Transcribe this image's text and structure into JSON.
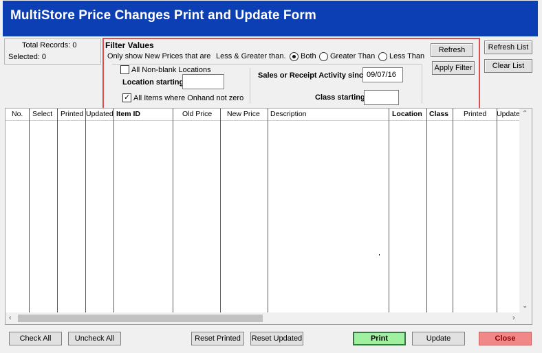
{
  "window": {
    "title": "MultiStore Price Changes Print and Update Form"
  },
  "stats": {
    "total_records": "Total Records: 0",
    "selected": "Selected: 0"
  },
  "filter": {
    "heading": "Filter Values",
    "only_show_label": "Only show New Prices that are",
    "less_greater_label": "Less & Greater than.",
    "radio_both": "Both",
    "radio_greater": "Greater Than",
    "radio_less": "Less Than",
    "selected_radio": "Both",
    "non_blank_label": "All Non-blank Locations",
    "non_blank_checked": false,
    "location_starting_label": "Location starting",
    "location_starting_value": "",
    "all_items_label": "All Items where Onhand not zero",
    "all_items_checked": true,
    "activity_label": "Sales or Receipt Activity since",
    "activity_date": "09/07/16",
    "class_starting_label": "Class starting",
    "class_starting_value": "",
    "refresh_label": "Refresh",
    "apply_filter_label": "Apply Filter"
  },
  "side_buttons": {
    "refresh_list": "Refresh List",
    "clear_list": "Clear List"
  },
  "grid": {
    "columns": [
      "No.",
      "Select",
      "Printed",
      "Updated",
      "Item ID",
      "Old Price",
      "New Price",
      "Description",
      "Location",
      "Class",
      "Printed",
      "Update"
    ],
    "rows": []
  },
  "bottom_buttons": {
    "check_all": "Check All",
    "uncheck_all": "Uncheck All",
    "reset_printed": "Reset Printed",
    "reset_updated": "Reset Updated",
    "print": "Print",
    "update": "Update",
    "close": "Close"
  },
  "colors": {
    "title_bar": "#0c3fb4",
    "print_button": "#9ff0a0",
    "close_button": "#f08888",
    "filter_border": "#d65050"
  }
}
